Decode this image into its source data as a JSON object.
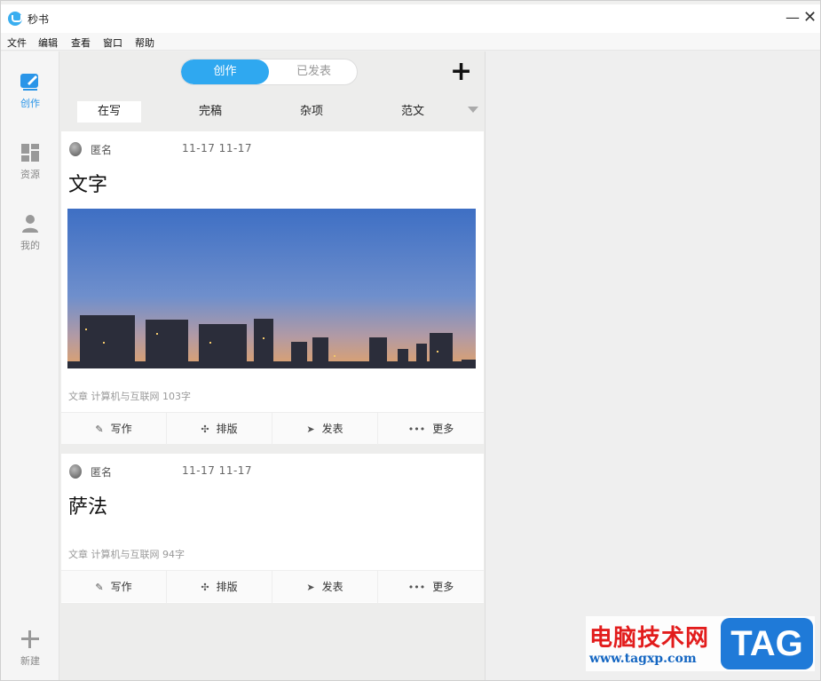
{
  "window": {
    "title": "秒书",
    "minimize": "—",
    "close": "✕"
  },
  "menu": [
    "文件",
    "编辑",
    "查看",
    "窗口",
    "帮助"
  ],
  "sidebar": {
    "items": [
      {
        "label": "创作",
        "icon": "write-icon",
        "active": true
      },
      {
        "label": "资源",
        "icon": "grid-icon",
        "active": false
      },
      {
        "label": "我的",
        "icon": "user-icon",
        "active": false
      }
    ],
    "new_label": "新建"
  },
  "segment": {
    "left": "创作",
    "right": "已发表"
  },
  "add_symbol": "+",
  "tabs": [
    "在写",
    "完稿",
    "杂项",
    "范文"
  ],
  "cards": [
    {
      "author": "匿名",
      "dates": "11-17   11-17",
      "title": "文字",
      "has_image": true,
      "meta": "文章   计算机与互联网   103字"
    },
    {
      "author": "匿名",
      "dates": "11-17   11-17",
      "title": "萨法",
      "has_image": false,
      "meta": "文章   计算机与互联网   94字"
    }
  ],
  "actions": [
    {
      "label": "写作",
      "icon": "pen-icon"
    },
    {
      "label": "排版",
      "icon": "layout-icon"
    },
    {
      "label": "发表",
      "icon": "send-icon"
    },
    {
      "label": "更多",
      "icon": "more-icon"
    }
  ],
  "watermark": {
    "cn": "电脑技术网",
    "url": "www.tagxp.com",
    "tag": "TAG"
  },
  "colors": {
    "accent": "#2fa8f0",
    "watermark_red": "#e21c1c",
    "watermark_blue": "#1f7ad8"
  }
}
